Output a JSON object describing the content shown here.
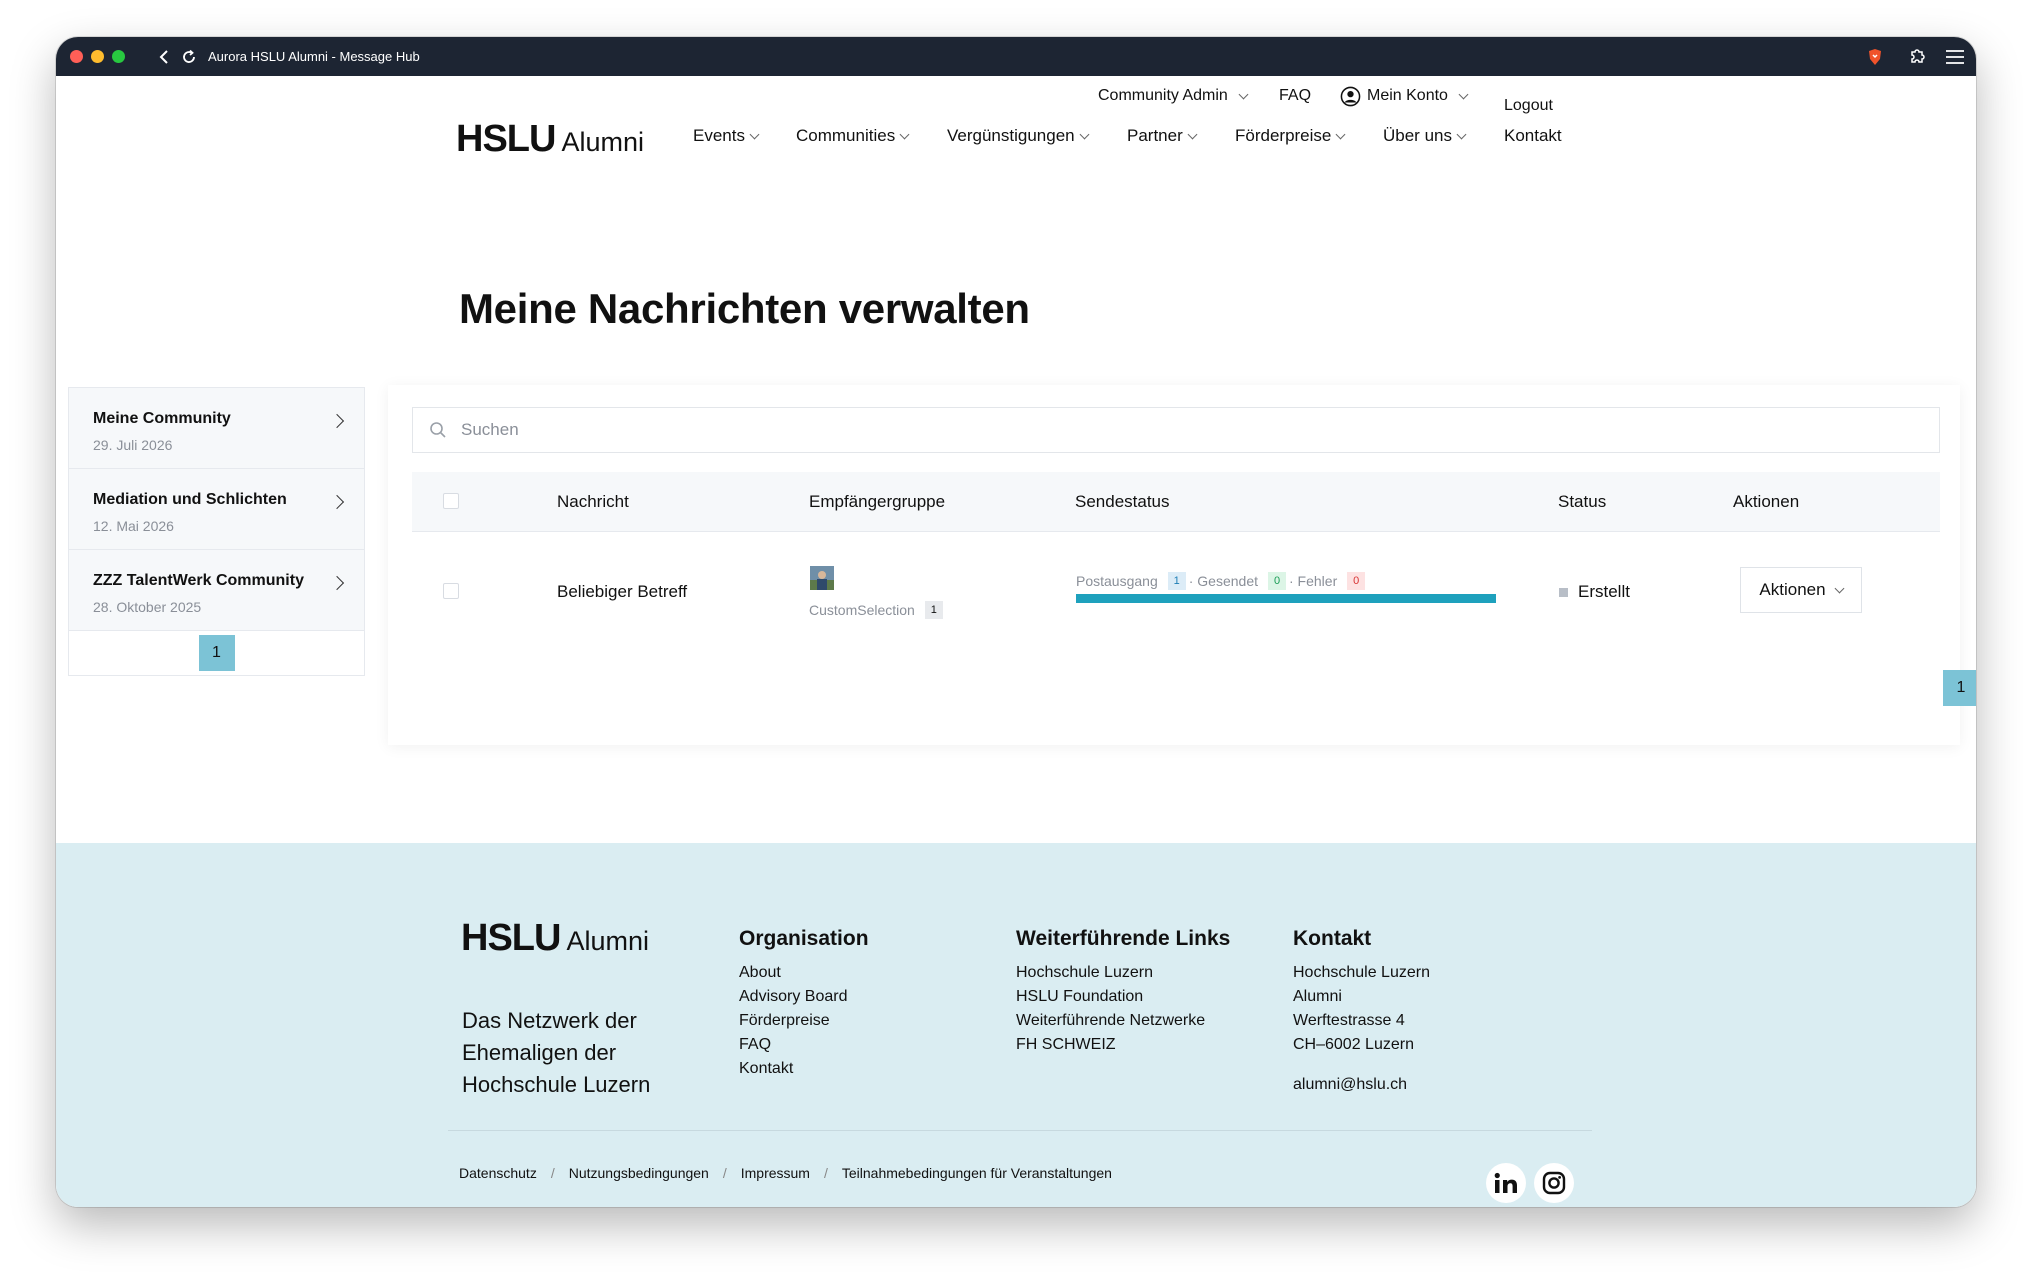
{
  "browser": {
    "title": "Aurora HSLU Alumni - Message Hub"
  },
  "topnav": {
    "community_admin": "Community Admin",
    "faq": "FAQ",
    "mein_konto": "Mein Konto",
    "logout": "Logout"
  },
  "logo": {
    "bold": "HSLU",
    "regular": "Alumni"
  },
  "mainnav": {
    "items": [
      "Events",
      "Communities",
      "Vergünstigungen",
      "Partner",
      "Förderpreise",
      "Über uns",
      "Kontakt"
    ]
  },
  "page": {
    "title": "Meine Nachrichten verwalten"
  },
  "sidebar": {
    "items": [
      {
        "title": "Meine Community",
        "date": "29. Juli 2026"
      },
      {
        "title": "Mediation und Schlichten",
        "date": "12. Mai 2026"
      },
      {
        "title": "ZZZ TalentWerk Community",
        "date": "28. Oktober 2025"
      }
    ],
    "page": "1"
  },
  "search": {
    "placeholder": "Suchen"
  },
  "table": {
    "headers": [
      "Nachricht",
      "Empfängergruppe",
      "Sendestatus",
      "Status",
      "Aktionen"
    ],
    "rows": [
      {
        "nachricht": "Beliebiger Betreff",
        "gruppe": "CustomSelection",
        "gruppe_count": "1",
        "postausgang_label": "Postausgang",
        "postausgang_count": "1",
        "gesendet_label": "· Gesendet",
        "gesendet_count": "0",
        "fehler_label": "· Fehler",
        "fehler_count": "0",
        "progress": 1.0,
        "status": "Erstellt",
        "aktionen": "Aktionen"
      }
    ],
    "page": "1"
  },
  "footer": {
    "logo_bold": "HSLU",
    "logo_regular": "Alumni",
    "description": "Das Netzwerk der Ehemaligen der Hochschule Luzern",
    "organisation": {
      "title": "Organisation",
      "links": [
        "About",
        "Advisory Board",
        "Förderpreise",
        "FAQ",
        "Kontakt"
      ]
    },
    "links": {
      "title": "Weiterführende Links",
      "links": [
        "Hochschule Luzern",
        "HSLU Foundation",
        "Weiterführende Netzwerke",
        "FH SCHWEIZ"
      ]
    },
    "kontakt": {
      "title": "Kontakt",
      "lines": [
        "Hochschule Luzern",
        "Alumni",
        "Werftestrasse 4",
        "CH–6002 Luzern"
      ],
      "email": "alumni@hslu.ch"
    },
    "bottom": [
      "Datenschutz",
      "Nutzungsbedingungen",
      "Impressum",
      "Teilnahmebedingungen für Veranstaltungen"
    ],
    "separator": "/"
  },
  "colors": {
    "accent": "#1ea1bd",
    "pager": "#7cc3d6",
    "footer_bg": "#daedf2",
    "titlebar": "#1d2533"
  }
}
